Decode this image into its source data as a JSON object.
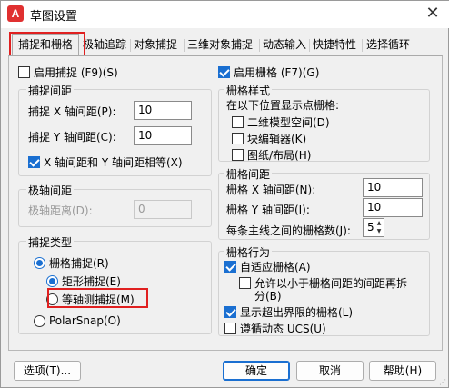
{
  "window": {
    "title": "草图设置",
    "app_icon": "A",
    "close_glyph": "✕"
  },
  "tabs": [
    {
      "label": "捕捉和栅格"
    },
    {
      "label": "极轴追踪"
    },
    {
      "label": "对象捕捉"
    },
    {
      "label": "三维对象捕捉"
    },
    {
      "label": "动态输入"
    },
    {
      "label": "快捷特性"
    },
    {
      "label": "选择循环"
    }
  ],
  "left": {
    "snap_on": {
      "label": "启用捕捉 (F9)(S)",
      "checked": false
    },
    "snap_spacing": {
      "title": "捕捉间距",
      "x_label": "捕捉 X 轴间距(P):",
      "x_value": "10",
      "y_label": "捕捉 Y 轴间距(C):",
      "y_value": "10",
      "equal_label": "X 轴间距和 Y 轴间距相等(X)",
      "equal_checked": true
    },
    "polar_spacing": {
      "title": "极轴间距",
      "distance_label": "极轴距离(D):",
      "distance_value": "0"
    },
    "snap_type": {
      "title": "捕捉类型",
      "grid_snap": "栅格捕捉(R)",
      "rect_snap": "矩形捕捉(E)",
      "iso_snap": "等轴测捕捉(M)",
      "polar_snap": "PolarSnap(O)",
      "selected": "rect_snap"
    }
  },
  "right": {
    "grid_on": {
      "label": "启用栅格 (F7)(G)",
      "checked": true
    },
    "grid_style": {
      "title": "栅格样式",
      "desc": "在以下位置显示点栅格:",
      "model_space": "二维模型空间(D)",
      "block_editor": "块编辑器(K)",
      "sheet_layout": "图纸/布局(H)"
    },
    "grid_spacing": {
      "title": "栅格间距",
      "x_label": "栅格 X 轴间距(N):",
      "x_value": "10",
      "y_label": "栅格 Y 轴间距(I):",
      "y_value": "10",
      "major_label": "每条主线之间的栅格数(J):",
      "major_value": "5"
    },
    "grid_behavior": {
      "title": "栅格行为",
      "adaptive": "自适应栅格(A)",
      "adaptive_checked": true,
      "subdivide_line1": "允许以小于栅格间距的间距再拆",
      "subdivide_line2": "分(B)",
      "subdivide_checked": false,
      "beyond_limits": "显示超出界限的栅格(L)",
      "beyond_checked": true,
      "follow_ucs": "遵循动态 UCS(U)",
      "follow_checked": false
    }
  },
  "buttons": {
    "options": "选项(T)...",
    "ok": "确定",
    "cancel": "取消",
    "help": "帮助(H)"
  },
  "colors": {
    "accent": "#1a6fd1",
    "highlight": "#e02020"
  }
}
